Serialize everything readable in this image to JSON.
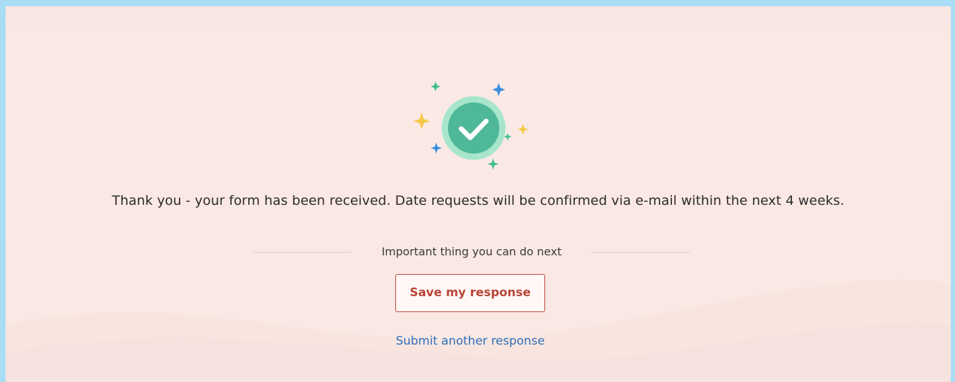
{
  "confirmation": {
    "message": "Thank you - your form has been received. Date requests will be confirmed via e-mail within the next 4 weeks.",
    "next_steps_heading": "Important thing you can do next",
    "save_button_label": "Save my response",
    "submit_another_label": "Submit another response",
    "icon": "check-circle-icon"
  },
  "colors": {
    "outer_frame": "#a9ddf5",
    "panel_background": "#f9e8e4",
    "save_button_accent": "#b8453a",
    "link": "#2f6fb8",
    "check_circle": "#4fb899",
    "sparkle_yellow": "#f7c948",
    "sparkle_blue": "#3a8ee0",
    "sparkle_green": "#3fbf8a"
  }
}
